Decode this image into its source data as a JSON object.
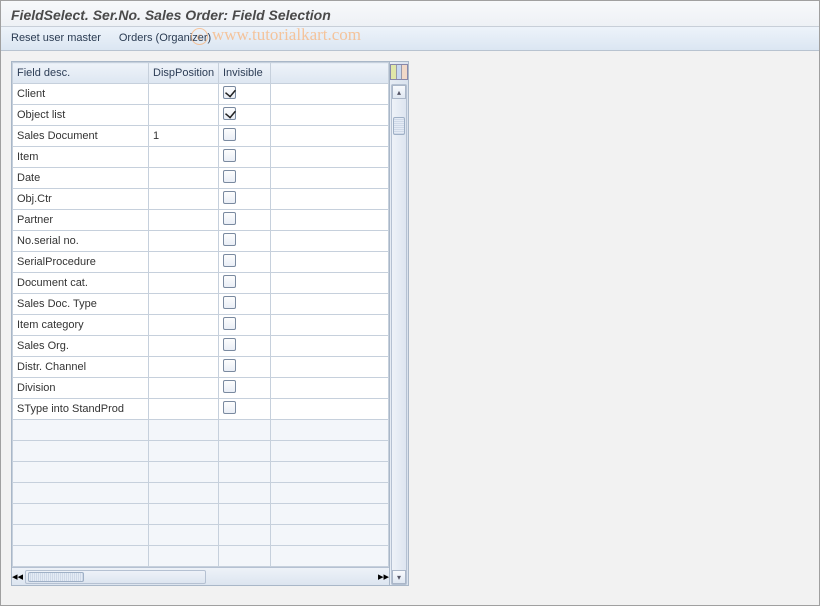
{
  "window": {
    "title": "FieldSelect. Ser.No. Sales Order: Field Selection"
  },
  "toolbar": {
    "reset_label": "Reset user master",
    "orders_label": "Orders (Organizer)"
  },
  "watermark": {
    "symbol": "c",
    "text": "www.tutorialkart.com"
  },
  "grid": {
    "headers": {
      "desc": "Field desc.",
      "disp": "DispPosition",
      "inv": "Invisible"
    },
    "rows": [
      {
        "desc": "Client",
        "disp": "",
        "inv": true
      },
      {
        "desc": "Object list",
        "disp": "",
        "inv": true
      },
      {
        "desc": "Sales Document",
        "disp": "1",
        "inv": false
      },
      {
        "desc": "Item",
        "disp": "",
        "inv": false
      },
      {
        "desc": "Date",
        "disp": "",
        "inv": false
      },
      {
        "desc": "Obj.Ctr",
        "disp": "",
        "inv": false
      },
      {
        "desc": "Partner",
        "disp": "",
        "inv": false
      },
      {
        "desc": "No.serial no.",
        "disp": "",
        "inv": false
      },
      {
        "desc": "SerialProcedure",
        "disp": "",
        "inv": false
      },
      {
        "desc": "Document cat.",
        "disp": "",
        "inv": false
      },
      {
        "desc": "Sales Doc. Type",
        "disp": "",
        "inv": false
      },
      {
        "desc": "Item category",
        "disp": "",
        "inv": false
      },
      {
        "desc": "Sales Org.",
        "disp": "",
        "inv": false
      },
      {
        "desc": "Distr. Channel",
        "disp": "",
        "inv": false
      },
      {
        "desc": "Division",
        "disp": "",
        "inv": false
      },
      {
        "desc": "SType into StandProd",
        "disp": "",
        "inv": false
      }
    ],
    "empty_rows": 7
  }
}
